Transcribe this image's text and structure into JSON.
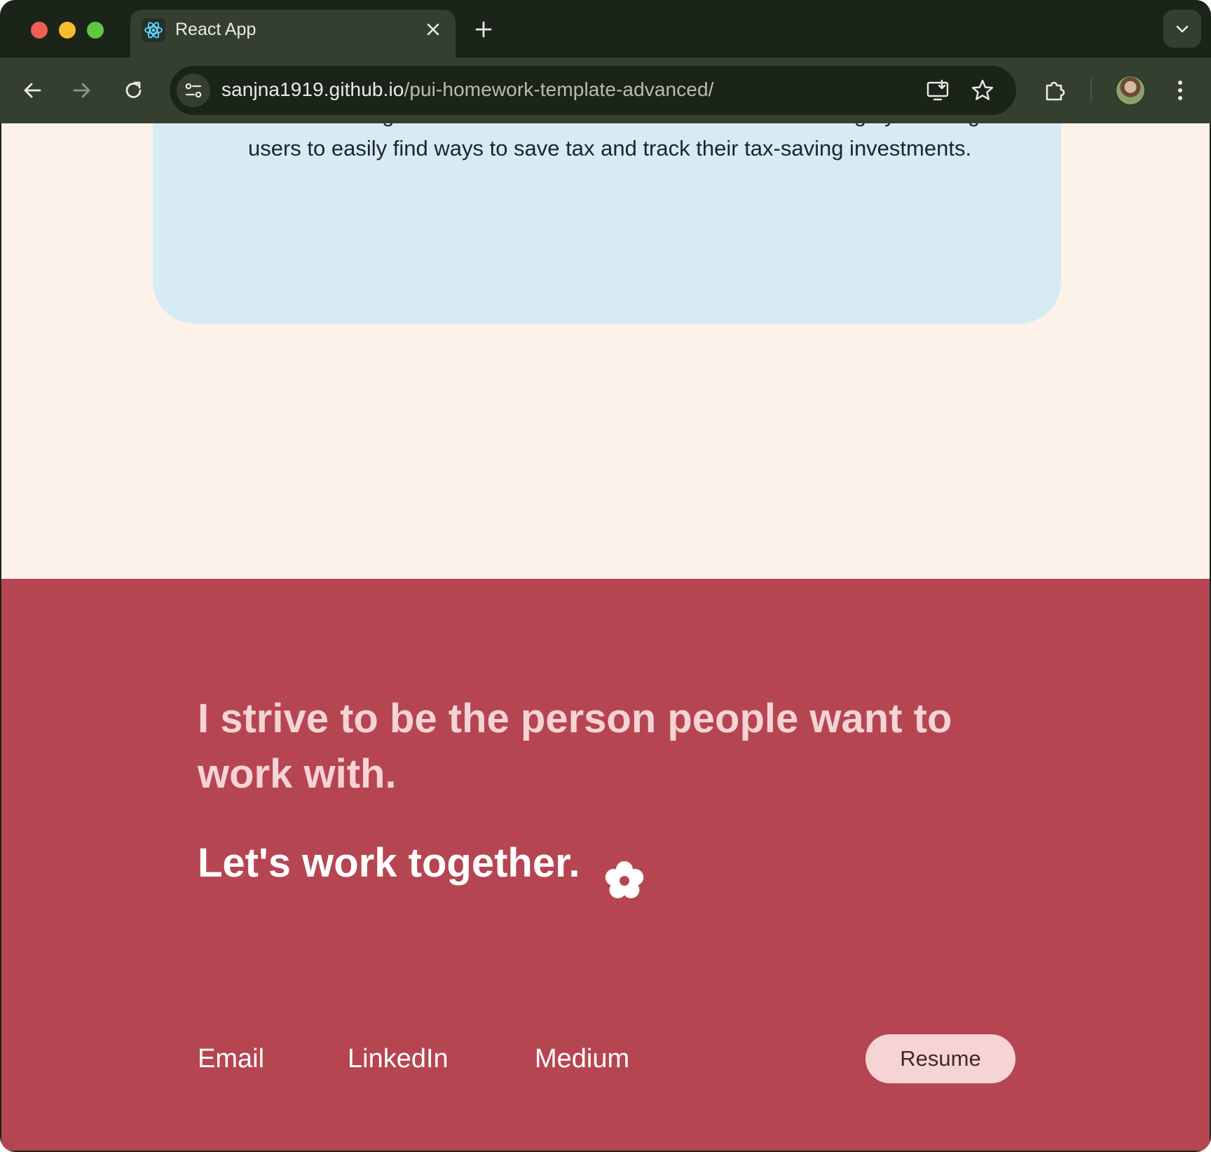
{
  "browser": {
    "tab": {
      "title": "React App",
      "favicon": "react-logo-icon"
    },
    "address_bar": {
      "host": "sanjna1919.github.io",
      "path": "/pui-homework-template-advanced/"
    },
    "icons": [
      "back-arrow-icon",
      "forward-arrow-icon",
      "reload-icon",
      "site-info-icon",
      "install-app-icon",
      "bookmark-star-icon",
      "extensions-icon",
      "profile-avatar",
      "more-menu-icon"
    ]
  },
  "project_card": {
    "description": "This tax-saving investment tracker makes taxes less intimidating by allowing users to easily find ways to save tax and track their tax-saving investments."
  },
  "footer": {
    "tagline": "I strive to be the person people want to work with.",
    "cta": "Let's work together.",
    "icon": "flower-icon",
    "links": {
      "email": "Email",
      "linkedin": "LinkedIn",
      "medium": "Medium"
    },
    "resume_label": "Resume"
  },
  "colors": {
    "page_background": "#FDF2E9",
    "card_background": "#D6EBF3",
    "footer_background": "#B64552",
    "tagline_text": "#F6D3D4",
    "resume_button": "#F6D3D4",
    "browser_frame": "#1B2419",
    "browser_toolbar": "#343F30"
  }
}
